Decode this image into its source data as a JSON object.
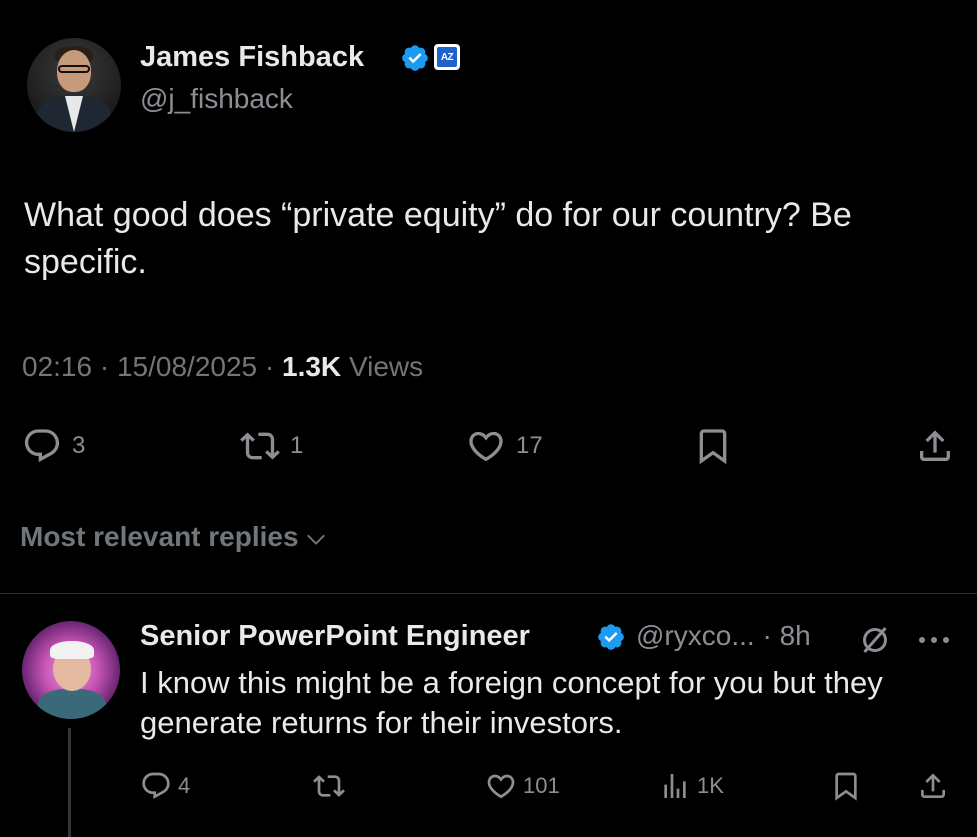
{
  "post": {
    "author": {
      "display_name": "James Fishback",
      "handle": "@j_fishback",
      "badge_text": "AZ"
    },
    "text": "What good does “private equity” do for our country? Be specific.",
    "time": "02:16",
    "date": "15/08/2025",
    "separator": "·",
    "views_count": "1.3K",
    "views_label": "Views",
    "stats": {
      "replies": "3",
      "reposts": "1",
      "likes": "17"
    }
  },
  "replies_sort": {
    "label": "Most relevant replies"
  },
  "reply": {
    "author": {
      "display_name": "Senior PowerPoint Engineer",
      "handle": "@ryxco...",
      "time": "8h"
    },
    "text": "I know this might be a foreign concept for you but they generate returns for their investors.",
    "stats": {
      "replies": "4",
      "likes": "101",
      "views": "1K"
    }
  },
  "colors": {
    "background": "#000000",
    "text_primary": "#e7e9ea",
    "text_secondary": "#71767b",
    "verified_blue": "#1d9bf0",
    "divider": "#2f3336"
  },
  "icons": [
    "verified-badge-icon",
    "affiliate-badge-icon",
    "reply-icon",
    "repost-icon",
    "like-icon",
    "bookmark-icon",
    "share-icon",
    "chevron-down-icon",
    "grok-icon",
    "more-icon",
    "views-icon"
  ]
}
